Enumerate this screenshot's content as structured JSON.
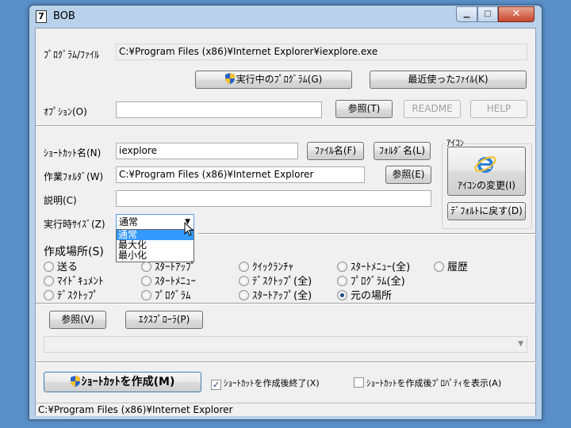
{
  "window": {
    "title": "BOB",
    "min_icon": "minimize-icon",
    "max_icon": "maximize-icon",
    "close_icon": "close-icon"
  },
  "program": {
    "label": "ﾌﾟﾛｸﾞﾗﾑ/ﾌｧｲﾙ",
    "value": "C:¥Program Files (x86)¥Internet Explorer¥iexplore.exe",
    "running_button": "実行中のﾌﾟﾛｸﾞﾗﾑ(G)",
    "recent_button": "最近使ったﾌｧｲﾙ(K)"
  },
  "options": {
    "label": "ｵﾌﾟｼｮﾝ(O)",
    "value": "",
    "browse_button": "参照(T)",
    "readme_button": "README",
    "help_button": "HELP"
  },
  "shortcut": {
    "name_label": "ｼｮｰﾄｶｯﾄ名(N)",
    "name_value": "iexplore",
    "filename_button": "ﾌｧｲﾙ名(F)",
    "foldername_button": "ﾌｫﾙﾀﾞ名(L)",
    "workdir_label": "作業ﾌｫﾙﾀﾞ(W)",
    "workdir_value": "C:¥Program Files (x86)¥Internet Explorer",
    "workdir_browse": "参照(E)",
    "desc_label": "説明(C)",
    "desc_value": "",
    "size_label": "実行時ｻｲｽﾞ(Z)",
    "size_selected": "通常",
    "size_options": [
      "通常",
      "最大化",
      "最小化"
    ]
  },
  "icon": {
    "group_label": "ｱｲｺﾝ",
    "change_button": "ｱｲｺﾝの変更(I)",
    "default_button": "ﾃﾞﾌｫﾙﾄに戻す(D)"
  },
  "location": {
    "label": "作成場所(S)",
    "radios": [
      {
        "label": "送る",
        "checked": false
      },
      {
        "label": "ｽﾀｰﾄｱｯﾌﾟ",
        "checked": false
      },
      {
        "label": "ｸｲｯｸﾗﾝﾁｬ",
        "checked": false
      },
      {
        "label": "ｽﾀｰﾄﾒﾆｭｰ(全)",
        "checked": false
      },
      {
        "label": "履歴",
        "checked": false
      },
      {
        "label": "ﾏｲﾄﾞｷｭﾒﾝﾄ",
        "checked": false
      },
      {
        "label": "ｽﾀｰﾄﾒﾆｭｰ",
        "checked": false
      },
      {
        "label": "ﾃﾞｽｸﾄｯﾌﾟ(全)",
        "checked": false
      },
      {
        "label": "ﾌﾟﾛｸﾞﾗﾑ(全)",
        "checked": false
      },
      {
        "label": "ﾃﾞｽｸﾄｯﾌﾟ",
        "checked": false
      },
      {
        "label": "ﾌﾟﾛｸﾞﾗﾑ",
        "checked": false
      },
      {
        "label": "ｽﾀｰﾄｱｯﾌﾟ(全)",
        "checked": false
      },
      {
        "label": "元の場所",
        "checked": true
      }
    ],
    "browse_button": "参照(V)",
    "explorer_button": "ｴｸｽﾌﾟﾛｰﾗ(P)",
    "path_combo": ""
  },
  "bottom": {
    "create_button": "ｼｮｰﾄｶｯﾄを作成(M)",
    "exit_after_label": "ｼｮｰﾄｶｯﾄを作成後終了(X)",
    "exit_after_checked": true,
    "props_after_label": "ｼｮｰﾄｶｯﾄを作成後ﾌﾟﾛﾊﾟﾃｨを表示(A)",
    "props_after_checked": false
  },
  "status": {
    "text": "C:¥Program Files (x86)¥Internet Explorer"
  },
  "colors": {
    "selection": "#3399ff",
    "title_bar": "#b9d1ea",
    "close_button": "#c7462d"
  }
}
